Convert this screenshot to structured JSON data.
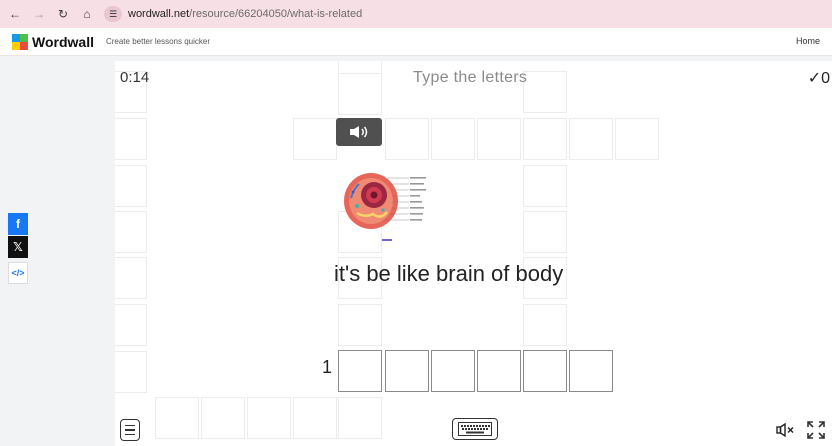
{
  "browser": {
    "url_host": "wordwall.net",
    "url_path": "/resource/66204050/what-is-related"
  },
  "header": {
    "logo_text": "Wordwall",
    "tagline": "Create better lessons quicker",
    "home_link": "Home"
  },
  "share": {
    "facebook_icon": "f",
    "x_icon": "𝕏",
    "embed_icon": "</>"
  },
  "game": {
    "timer": "0:14",
    "title": "Type the letters",
    "score": "✓0",
    "clue_text": "it's be like brain of body",
    "clue_number": "1",
    "speaker_icon": "speaker-icon",
    "menu_icon": "menu-icon",
    "keyboard_icon": "keyboard-icon",
    "mute_icon": "mute-icon",
    "fullscreen_icon": "fullscreen-icon"
  },
  "colors": {
    "browser_bar": "#f7dfe6",
    "stage_bg": "#ffffff",
    "speaker_bg": "#505050",
    "logo_blue": "#1a9ae0",
    "logo_green": "#4cbf4c",
    "logo_yellow": "#ffcc00",
    "logo_red": "#e94b3c"
  }
}
